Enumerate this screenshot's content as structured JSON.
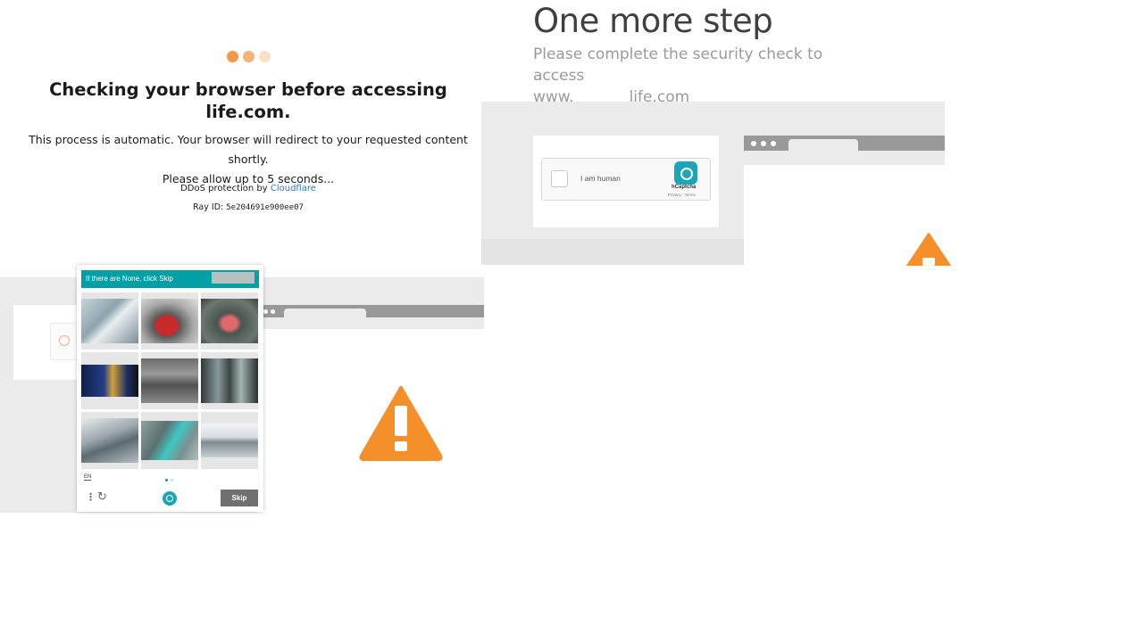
{
  "cf_check": {
    "title": "Checking your browser before accessing life.com.",
    "line1": "This process is automatic. Your browser will redirect to your requested content shortly.",
    "line2": "Please allow up to 5 seconds...",
    "ddos_prefix": "DDoS protection by",
    "ddos_link": "Cloudflare",
    "ray_label": "Ray ID:",
    "ray_id": "5e204691e900ee07",
    "accent_color": "#f0994a"
  },
  "one_more_step": {
    "title": "One more step",
    "subtitle": "Please complete the security check to access",
    "domain_prefix": "www.",
    "domain_suffix": "life.com"
  },
  "hcaptcha_checkbox": {
    "label": "I am human",
    "brand": "hCaptcha",
    "links": "Privacy - Terms",
    "icon": "hcaptcha-logo-icon"
  },
  "hcaptcha_challenge": {
    "prompt": "If there are None, click Skip",
    "language": "EN",
    "skip_label": "Skip",
    "header_color": "#00a0a6",
    "images": [
      "vehicle-interior",
      "red-sports-car",
      "boat-in-water",
      "bus",
      "train-platform",
      "train",
      "boat-wave",
      "hand-in-water",
      "seaplane"
    ]
  },
  "warning_icon": {
    "icon": "warning-icon",
    "color": "#f48f2a"
  }
}
